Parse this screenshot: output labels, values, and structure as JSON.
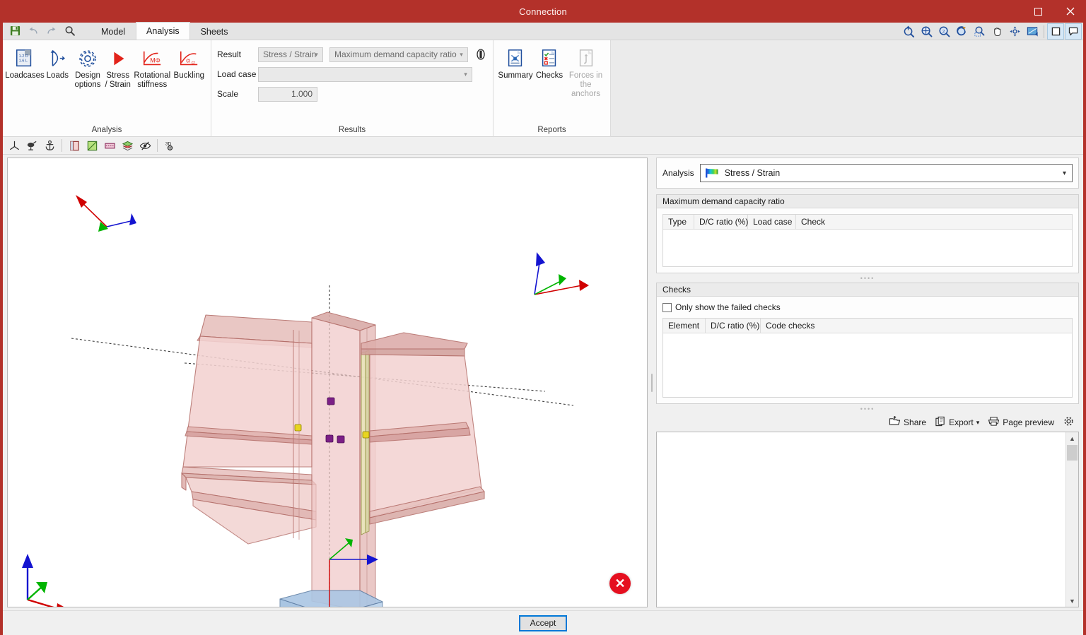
{
  "window": {
    "title": "Connection",
    "controls": [
      {
        "name": "maximize-button",
        "glyph": "☐"
      },
      {
        "name": "close-button",
        "glyph": "✕"
      }
    ]
  },
  "quick_access": [
    {
      "name": "save-icon",
      "label": "Save"
    },
    {
      "name": "undo-icon",
      "label": "Undo"
    },
    {
      "name": "redo-icon",
      "label": "Redo"
    },
    {
      "name": "search-icon",
      "label": "Search"
    }
  ],
  "tabs": [
    {
      "label": "Model",
      "active": false
    },
    {
      "label": "Analysis",
      "active": true
    },
    {
      "label": "Sheets",
      "active": false
    }
  ],
  "top_right_tools": [
    {
      "name": "zoom-window-icon",
      "label": "Zoom window"
    },
    {
      "name": "zoom-all-icon",
      "label": "Zoom all"
    },
    {
      "name": "zoom-previous-icon",
      "label": "Zoom previous"
    },
    {
      "name": "rotate-icon",
      "label": "Rotate"
    },
    {
      "name": "zoom-selected-icon",
      "label": "Zoom selected"
    },
    {
      "name": "pan-icon",
      "label": "Pan"
    },
    {
      "name": "orbit-icon",
      "label": "Orbit"
    },
    {
      "name": "render-icon",
      "label": "Render style"
    },
    {
      "name": "single-view-icon",
      "label": "Single view"
    },
    {
      "name": "comment-icon",
      "label": "Comments"
    }
  ],
  "ribbon": {
    "groups": [
      {
        "title": "Analysis",
        "buttons": [
          {
            "name": "loadcases-button",
            "label": "Loadcases",
            "icon": "loadcases-icon",
            "disabled": false
          },
          {
            "name": "loads-button",
            "label": "Loads",
            "icon": "loads-icon",
            "disabled": false
          },
          {
            "name": "design-options-button",
            "label": "Design\noptions",
            "label1": "Design",
            "label2": "options",
            "icon": "gear-icon",
            "disabled": false
          },
          {
            "name": "stress-strain-button",
            "label1": "Stress",
            "label2": "/ Strain",
            "icon": "play-icon",
            "disabled": false
          },
          {
            "name": "rotational-stiffness-button",
            "label1": "Rotational",
            "label2": "stiffness",
            "icon": "moment-rotation-icon",
            "disabled": false
          },
          {
            "name": "buckling-button",
            "label1": "Buckling",
            "label2": "",
            "icon": "alpha-cr-icon",
            "disabled": false
          }
        ]
      },
      {
        "title": "Results",
        "fields": {
          "result_label": "Result",
          "result_value": "Stress / Strain",
          "result_secondary_value": "Maximum demand capacity ratio",
          "load_case_label": "Load case",
          "load_case_value": "",
          "scale_label": "Scale",
          "scale_value": "1.000",
          "legend_toggle_name": "color-legend-toggle-icon"
        }
      },
      {
        "title": "Reports",
        "buttons": [
          {
            "name": "summary-button",
            "label1": "Summary",
            "label2": "",
            "icon": "summary-report-icon",
            "disabled": false
          },
          {
            "name": "checks-button",
            "label1": "Checks",
            "label2": "",
            "icon": "checks-report-icon",
            "disabled": false
          },
          {
            "name": "forces-in-the-anchors-button",
            "label1": "Forces in",
            "label2": "the anchors",
            "icon": "anchor-forces-icon",
            "disabled": true
          }
        ]
      }
    ]
  },
  "view_toolbar": [
    {
      "name": "axes-icon",
      "label": "Show axes"
    },
    {
      "name": "supports-icon",
      "label": "Show supports"
    },
    {
      "name": "anchor-icon",
      "label": "Show anchors"
    },
    {
      "name": "mesh-colors-icon",
      "label": "Mesh colors"
    },
    {
      "name": "surface-plot-icon",
      "label": "Surface plot"
    },
    {
      "name": "deformed-shape-icon",
      "label": "Deformed shape"
    },
    {
      "name": "layers-icon",
      "label": "Layers"
    },
    {
      "name": "hide-icon",
      "label": "Hide"
    },
    {
      "name": "3d-view-icon",
      "label": "3D view"
    }
  ],
  "viewport": {
    "error_badge": {
      "name": "error-badge",
      "glyph": "✕"
    },
    "axes_triads": [
      {
        "name": "member-axis-triad-left"
      },
      {
        "name": "member-axis-triad-right"
      },
      {
        "name": "member-axis-triad-bottom"
      },
      {
        "name": "global-axis-triad"
      }
    ]
  },
  "right_panel": {
    "analysis": {
      "label": "Analysis",
      "value": "Stress / Strain",
      "icon": "color-gradient-flag-icon"
    },
    "max_dc": {
      "title": "Maximum demand capacity ratio",
      "columns": [
        "Type",
        "D/C ratio (%)",
        "Load case",
        "Check"
      ],
      "rows": []
    },
    "checks": {
      "title": "Checks",
      "filter_label": "Only show the failed checks",
      "filter_checked": false,
      "columns": [
        "Element",
        "D/C ratio (%)",
        "Code checks"
      ],
      "rows": []
    },
    "report_tools": [
      {
        "name": "share-button",
        "label": "Share",
        "icon": "share-icon"
      },
      {
        "name": "export-button",
        "label": "Export",
        "icon": "export-icon",
        "caret": "▾"
      },
      {
        "name": "page-preview-button",
        "label": "Page preview",
        "icon": "printer-icon"
      },
      {
        "name": "report-settings-button",
        "label": "",
        "icon": "gear-icon"
      }
    ]
  },
  "footer": {
    "accept_label": "Accept"
  },
  "colors": {
    "title_bar": "#b3312a",
    "accent_red": "#c0392b",
    "error": "#e50f1f",
    "focus_blue": "#0078d7",
    "model_fill": "#f2cdcd",
    "model_edge": "#b5706b",
    "base_plate": "#a8c4e0"
  }
}
